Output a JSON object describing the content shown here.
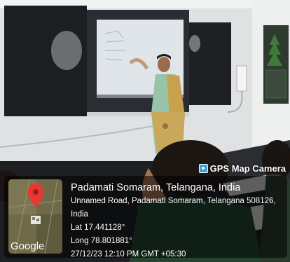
{
  "badge": {
    "icon": "camera-icon",
    "label": "GPS Map Camera"
  },
  "location": {
    "title": "Padamati Somaram, Telangana, India",
    "address": "Unnamed Road, Padamati Somaram, Telangana 508126, India",
    "lat": "Lat 17.441128°",
    "long": "Long 78.801881°",
    "datetime": "27/12/23 12:10 PM GMT +05:30"
  },
  "map": {
    "brand": "Google",
    "pin_color": "#e53935"
  }
}
